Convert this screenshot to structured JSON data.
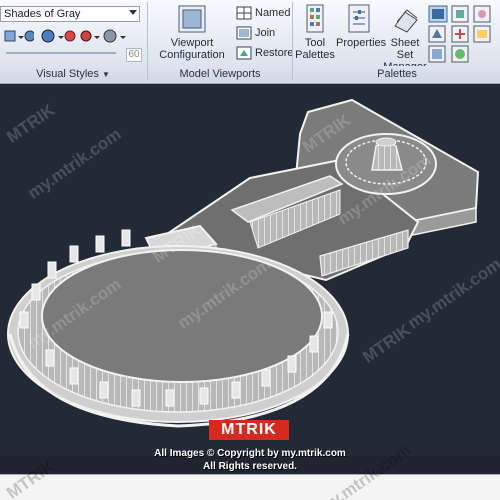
{
  "ribbon": {
    "visual_style_value": "Shades of Gray",
    "visual_styles_panel_title": "Visual Styles",
    "model_viewports_panel_title": "Model Viewports",
    "palettes_panel_title": "Palettes",
    "viewport_configuration_label_1": "Viewport",
    "viewport_configuration_label_2": "Configuration",
    "named_label": "Named",
    "join_label": "Join",
    "restore_label": "Restore",
    "tool_palettes_label_1": "Tool",
    "tool_palettes_label_2": "Palettes",
    "properties_label": "Properties",
    "sheet_set_manager_label_1": "Sheet Set",
    "sheet_set_manager_label_2": "Manager",
    "slider_value": "60"
  },
  "overlay": {
    "logo_text": "MTRIK",
    "copyright_line_1": "All Images © Copyright by my.mtrik.com",
    "copyright_line_2": "All Rights reserved.",
    "watermark_brand": "MTRIK",
    "watermark_url": "my.mtrik.com"
  },
  "colors": {
    "viewport_bg": "#222a35",
    "model_surface": "#7a7a7a",
    "model_edges": "#f2f2f2",
    "logo_red": "#d42a1f"
  }
}
